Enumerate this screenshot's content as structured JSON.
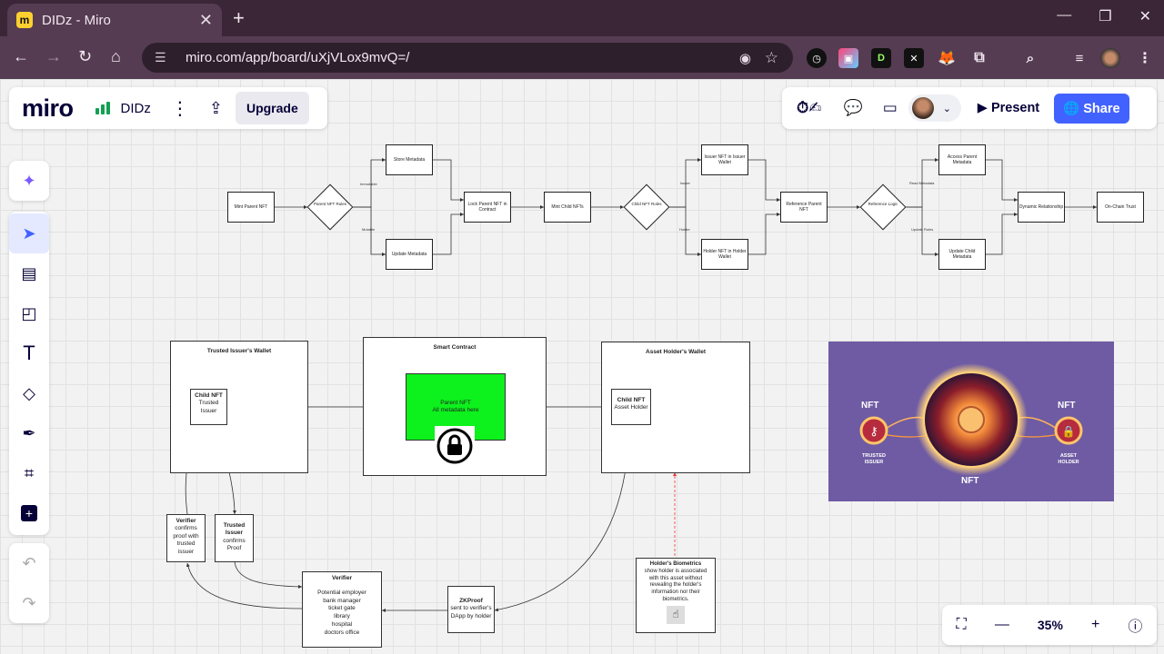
{
  "browser": {
    "tab_title": "DIDz - Miro",
    "favicon": "m",
    "url": "miro.com/app/board/uXjVLox9mvQ=/",
    "colors": {
      "frame": "#3a2637",
      "toolbar": "#553c52"
    }
  },
  "miro": {
    "logo": "miro",
    "board_name": "DIDz",
    "upgrade_label": "Upgrade",
    "present_label": "Present",
    "share_label": "Share",
    "zoom_level": "35%",
    "accent": "#4262ff"
  },
  "tools": [
    "ai-assist-icon",
    "select-icon",
    "template-icon",
    "sticky-note-icon",
    "text-icon",
    "shapes-icon",
    "pen-icon",
    "frame-icon",
    "more-icon"
  ],
  "flowchart": {
    "mint_parent": "Mint Parent NFT",
    "parent_rules": "Parent NFT Rules",
    "immutable": "Immutable",
    "mutable": "Mutable",
    "store_metadata": "Store Metadata",
    "update_metadata": "Update Metadata",
    "lock_parent": "Lock Parent NFT in Contract",
    "mint_child": "Mint Child NFTs",
    "child_roles": "Child NFT Roles",
    "issuer": "Issuer",
    "holder": "Holder",
    "issuer_nft": "Issuer NFT in Issuer Wallet",
    "holder_nft": "Holder NFT in Holder Wallet",
    "reference_parent": "Reference Parent NFT",
    "reference_logic": "Reference Logic",
    "read_metadata": "Read Metadata",
    "update_rules": "Update Rules",
    "access_parent": "Access Parent Metadata",
    "update_child": "Update Child Metadata",
    "dynamic": "Dynamic Relationship",
    "onchain": "On-Chain Trust"
  },
  "diagram": {
    "issuer_wallet_title": "Trusted Issuer's Wallet",
    "smart_contract_title": "Smart Contract",
    "holder_wallet_title": "Asset Holder's Wallet",
    "child_nft_issuer": {
      "title": "Child NFT",
      "sub1": "Trusted",
      "sub2": "Issuer"
    },
    "parent_nft": {
      "title": "Parent NFT",
      "sub": "All metadata here"
    },
    "child_nft_holder": {
      "title": "Child NFT",
      "sub": "Asset Holder"
    },
    "verifier_small": {
      "title": "Verifier",
      "l1": "confirms",
      "l2": "proof with",
      "l3": "trusted",
      "l4": "issuer"
    },
    "trusted_issuer_small": {
      "title": "Trusted",
      "title2": "Issuer",
      "l1": "confirms",
      "l2": "Proof"
    },
    "verifier_big": {
      "title": "Verifier",
      "l1": "Potential employer",
      "l2": "bank manager",
      "l3": "ticket gate",
      "l4": "library",
      "l5": "hospital",
      "l6": "doctors office"
    },
    "zkproof": {
      "title": "ZKProof",
      "l1": "sent to verifier's",
      "l2": "DApp by holder"
    },
    "biometrics": {
      "title": "Holder's Biometrics",
      "l1": "show holder is associated",
      "l2": "with this asset without",
      "l3": "revealing the holder's",
      "l4": "information nor their",
      "l5": "biometrics."
    }
  },
  "image_panel": {
    "nft_left": "NFT",
    "nft_right": "NFT",
    "nft_bottom": "NFT",
    "left_caption_1": "TRUSTED",
    "left_caption_2": "ISSUER",
    "right_caption_1": "ASSET",
    "right_caption_2": "HOLDER",
    "bg": "#6e5ba3"
  }
}
